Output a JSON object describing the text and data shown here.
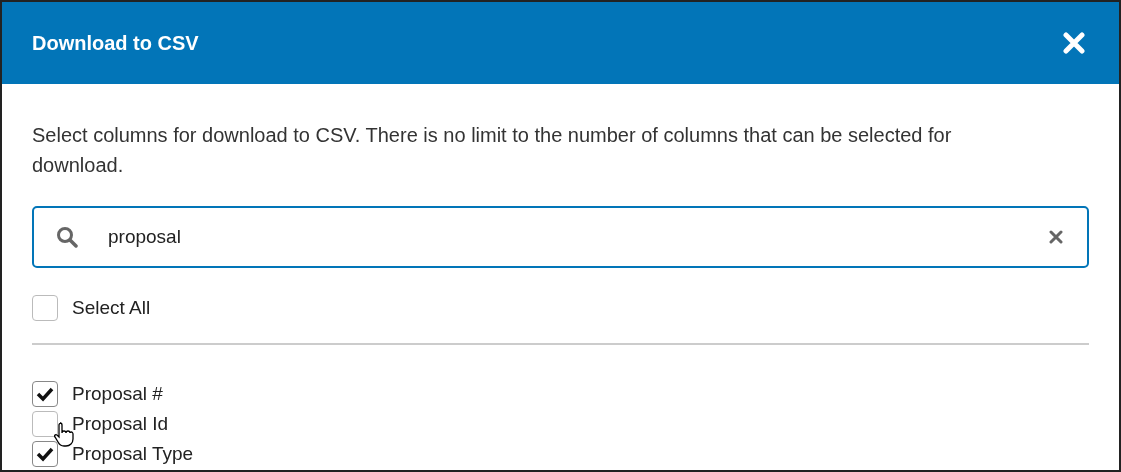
{
  "dialog": {
    "title": "Download to CSV",
    "description": "Select columns for download to CSV. There is no limit to the number of columns that can be selected for download.",
    "search": {
      "value": "proposal"
    },
    "select_all": {
      "label": "Select All",
      "checked": false
    },
    "columns": [
      {
        "label": "Proposal #",
        "checked": true
      },
      {
        "label": "Proposal Id",
        "checked": false
      },
      {
        "label": "Proposal Type",
        "checked": true
      }
    ]
  }
}
